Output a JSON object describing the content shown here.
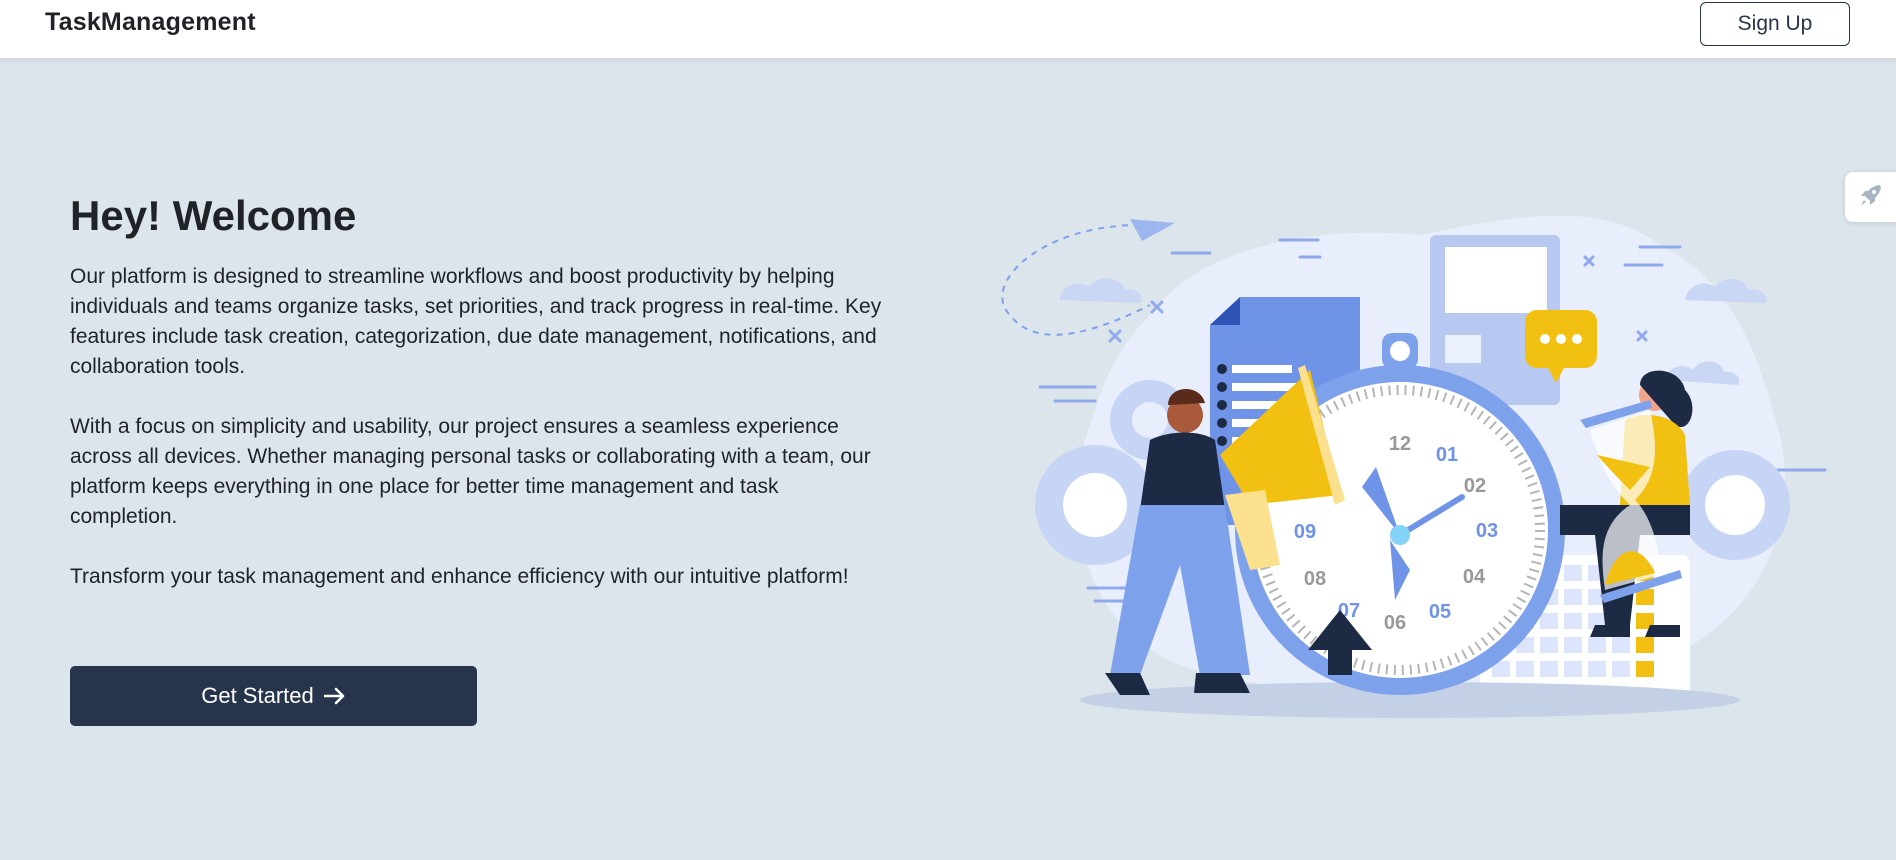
{
  "navbar": {
    "brand": "TaskManagement",
    "signup_label": "Sign Up"
  },
  "hero": {
    "title": "Hey! Welcome",
    "paragraphs": [
      "Our platform is designed to streamline workflows and boost productivity by helping individuals and teams organize tasks, set priorities, and track progress in real-time. Key features include task creation, categorization, due date management, notifications, and collaboration tools.",
      "With a focus on simplicity and usability, our project ensures a seamless experience across all devices. Whether managing personal tasks or collaborating with a team, our platform keeps everything in one place for better time management and task completion.",
      "Transform your task management and enhance efficiency with our intuitive platform!"
    ],
    "cta_label": "Get Started"
  },
  "illustration": {
    "clock_numbers": [
      "12",
      "01",
      "02",
      "03",
      "04",
      "05",
      "06",
      "07",
      "08",
      "09"
    ]
  },
  "side_widget": {
    "icon": "rocket-icon"
  },
  "colors": {
    "background": "#dce4ec",
    "navbar": "#ffffff",
    "primary": "#26354b",
    "illustration_blue": "#7ea1ec",
    "illustration_yellow": "#f2c010"
  }
}
